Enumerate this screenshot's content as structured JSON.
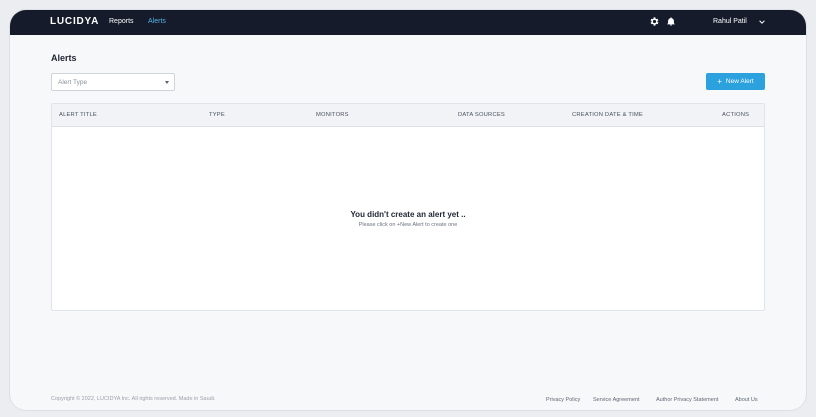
{
  "topbar": {
    "brand": "LUCIDYA",
    "nav": [
      {
        "label": "Reports"
      },
      {
        "label": "Alerts"
      }
    ],
    "user_name": "Rahul Patil",
    "active_color": "#4fb3e8",
    "background": "#151b2b"
  },
  "page": {
    "title": "Alerts"
  },
  "filter": {
    "placeholder": "Alert Type"
  },
  "new_alert_button": {
    "label": "New Alert",
    "color": "#2ba1de"
  },
  "table": {
    "columns": [
      "ALERT TITLE",
      "TYPE",
      "MONITORS",
      "DATA SOURCES",
      "CREATION DATE & TIME",
      "ACTIONS"
    ],
    "empty_title": "You didn't create an alert yet ..",
    "empty_subtitle": "Please click on +New Alert to create one"
  },
  "footer": {
    "copyright": "Copyright © 2022, LUCIDYA Inc. All rights reserved. Made in Saudi.",
    "links": [
      "Privacy Policy",
      "Service Agreement",
      "Author Privacy Statement",
      "About Us"
    ]
  },
  "icons": {
    "settings": "gear-icon",
    "notifications": "bell-icon",
    "user_menu": "chevron-down-icon",
    "add": "plus-icon",
    "dropdown": "caret-down-icon"
  }
}
